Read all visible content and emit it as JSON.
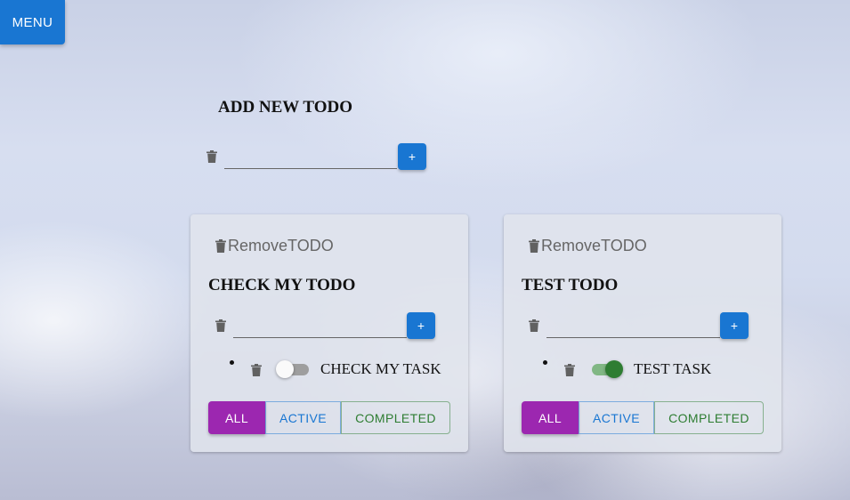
{
  "menu": {
    "label": "MENU"
  },
  "add_section": {
    "title": "ADD NEW TODO",
    "input_value": "",
    "add_label": "+"
  },
  "todos": [
    {
      "remove_label": "RemoveTODO",
      "title": "CHECK MY TODO",
      "input_value": "",
      "add_label": "+",
      "task": {
        "label": "CHECK MY TASK",
        "done": false
      },
      "filters": {
        "all": "ALL",
        "active": "ACTIVE",
        "completed": "COMPLETED"
      }
    },
    {
      "remove_label": "RemoveTODO",
      "title": "TEST TODO",
      "input_value": "",
      "add_label": "+",
      "task": {
        "label": "TEST TASK",
        "done": true
      },
      "filters": {
        "all": "ALL",
        "active": "ACTIVE",
        "completed": "COMPLETED"
      }
    }
  ],
  "colors": {
    "primary": "#1976d2",
    "secondary": "#9c27b0",
    "success": "#2e7d32"
  },
  "icons": {
    "delete": "trash-icon"
  }
}
